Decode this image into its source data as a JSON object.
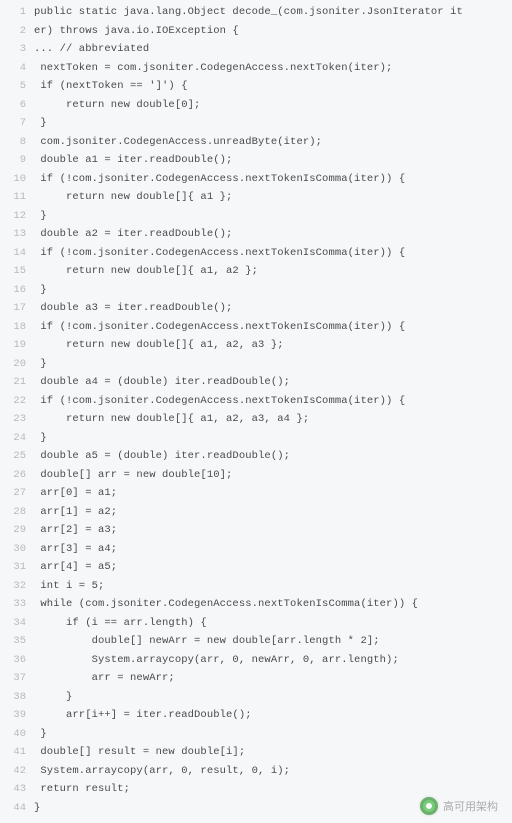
{
  "code": {
    "lines": [
      "public static java.lang.Object decode_(com.jsoniter.JsonIterator it",
      "er) throws java.io.IOException {",
      "... // abbreviated",
      " nextToken = com.jsoniter.CodegenAccess.nextToken(iter);",
      " if (nextToken == ']') {",
      "     return new double[0];",
      " }",
      " com.jsoniter.CodegenAccess.unreadByte(iter);",
      " double a1 = iter.readDouble();",
      " if (!com.jsoniter.CodegenAccess.nextTokenIsComma(iter)) {",
      "     return new double[]{ a1 };",
      " }",
      " double a2 = iter.readDouble();",
      " if (!com.jsoniter.CodegenAccess.nextTokenIsComma(iter)) {",
      "     return new double[]{ a1, a2 };",
      " }",
      " double a3 = iter.readDouble();",
      " if (!com.jsoniter.CodegenAccess.nextTokenIsComma(iter)) {",
      "     return new double[]{ a1, a2, a3 };",
      " }",
      " double a4 = (double) iter.readDouble();",
      " if (!com.jsoniter.CodegenAccess.nextTokenIsComma(iter)) {",
      "     return new double[]{ a1, a2, a3, a4 };",
      " }",
      " double a5 = (double) iter.readDouble();",
      " double[] arr = new double[10];",
      " arr[0] = a1;",
      " arr[1] = a2;",
      " arr[2] = a3;",
      " arr[3] = a4;",
      " arr[4] = a5;",
      " int i = 5;",
      " while (com.jsoniter.CodegenAccess.nextTokenIsComma(iter)) {",
      "     if (i == arr.length) {",
      "         double[] newArr = new double[arr.length * 2];",
      "         System.arraycopy(arr, 0, newArr, 0, arr.length);",
      "         arr = newArr;",
      "     }",
      "     arr[i++] = iter.readDouble();",
      " }",
      " double[] result = new double[i];",
      " System.arraycopy(arr, 0, result, 0, i);",
      " return result;",
      "}"
    ]
  },
  "watermark": {
    "text": "高可用架构"
  }
}
